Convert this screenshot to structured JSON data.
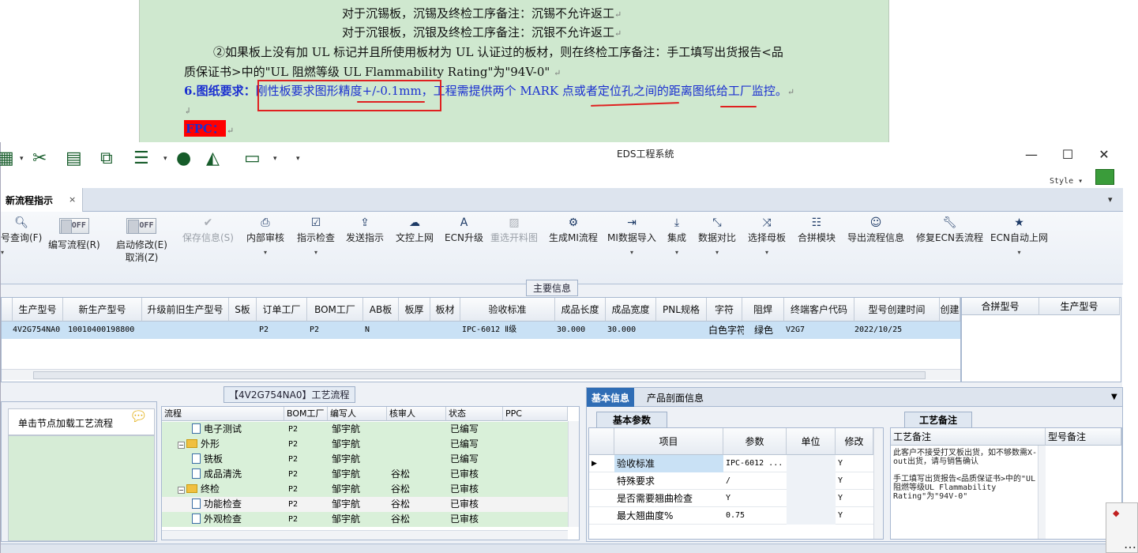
{
  "document": {
    "line1": "对于沉锡板，沉锡及终检工序备注：沉锡不允许返工",
    "line2": "对于沉银板，沉银及终检工序备注：沉银不允许返工",
    "line3": "②如果板上没有加 UL 标记并且所使用板材为 UL 认证过的板材，则在终检工序备注：手工填写出货报告<品",
    "line4": "质保证书>中的\"UL 阻燃等级 UL Flammability Rating\"为\"94V-0\"",
    "line5_label": "6.图纸要求：",
    "line5_text": "刚性板要求图形精度+/-0.1mm，工程需提供两个 MARK 点或者定位孔之间的距离图纸给工厂监控。",
    "fpc_label": "FPC：",
    "para_mark": "↵",
    "return_mark": "↲"
  },
  "window": {
    "title": "EDS工程系统",
    "minimize": "—",
    "maximize": "☐",
    "close": "✕",
    "style_label": "Style ▾",
    "quick_access_more": "▾"
  },
  "tabs": {
    "active": "新流程指示",
    "close": "×",
    "dropdown": "▾"
  },
  "ribbon": {
    "query": "号查询(F)",
    "edit_flow_toggle": "OFF",
    "edit_flow": "编写流程(R)",
    "start_modify_toggle": "OFF",
    "start_modify": "启动修改(E)",
    "cancel": "取消(Z)",
    "save_info": "保存信息(S)",
    "internal_review": "内部审核",
    "instruction_check": "指示检查",
    "send_instruction": "发送指示",
    "doc_upload": "文控上网",
    "ecn_upgrade": "ECN升级",
    "reselect_cut": "重选开料图",
    "generate_mi": "生成MI流程",
    "mi_import": "MI数据导入",
    "integrate": "集成",
    "data_compare": "数据对比",
    "select_master": "选择母板",
    "merge_module": "合拼模块",
    "export_flow": "导出流程信息",
    "fix_ecn": "修复ECN丢流程",
    "ecn_auto_upload": "ECN自动上网"
  },
  "main_info": {
    "label": "主要信息",
    "headers": [
      "生产型号",
      "新生产型号",
      "升级前旧生产型号",
      "S板",
      "订单工厂",
      "BOM工厂",
      "AB板",
      "板厚",
      "板材",
      "验收标准",
      "成品长度",
      "成品宽度",
      "PNL规格",
      "字符",
      "阻焊",
      "终端客户代码",
      "型号创建时间",
      "创建"
    ],
    "row": [
      "4V2G754NA0",
      "10010400198800",
      "",
      "",
      "P2",
      "P2",
      "N",
      "",
      "",
      "IPC-6012 Ⅱ级",
      "30.000",
      "30.000",
      "",
      "白色字符",
      "绿色",
      "V2G7",
      "2022/10/25",
      ""
    ],
    "side_headers": [
      "合拼型号",
      "生产型号"
    ]
  },
  "process": {
    "label": "【4V2G754NA0】工艺流程",
    "load_hint": "单击节点加载工艺流程",
    "headers": [
      "流程",
      "BOM工厂",
      "编写人",
      "核审人",
      "状态",
      "PPC"
    ],
    "rows": [
      {
        "name": "电子测试",
        "bom": "P2",
        "writer": "邹宇航",
        "reviewer": "",
        "status": "已编写",
        "type": "file",
        "indent": 2
      },
      {
        "name": "外形",
        "bom": "P2",
        "writer": "邹宇航",
        "reviewer": "",
        "status": "已编写",
        "type": "folder",
        "indent": 1
      },
      {
        "name": "铣板",
        "bom": "P2",
        "writer": "邹宇航",
        "reviewer": "",
        "status": "已编写",
        "type": "file",
        "indent": 2
      },
      {
        "name": "成品清洗",
        "bom": "P2",
        "writer": "邹宇航",
        "reviewer": "谷松",
        "status": "已审核",
        "type": "file",
        "indent": 2
      },
      {
        "name": "终检",
        "bom": "P2",
        "writer": "邹宇航",
        "reviewer": "谷松",
        "status": "已审核",
        "type": "folder",
        "indent": 1
      },
      {
        "name": "功能检查",
        "bom": "P2",
        "writer": "邹宇航",
        "reviewer": "谷松",
        "status": "已审核",
        "type": "file",
        "indent": 2
      },
      {
        "name": "外观检查",
        "bom": "P2",
        "writer": "邹宇航",
        "reviewer": "谷松",
        "status": "已审核",
        "type": "file",
        "indent": 2
      }
    ]
  },
  "right_panel": {
    "tab_basic": "基本信息",
    "tab_profile": "产品剖面信息",
    "basic_params_tab": "基本参数",
    "param_headers": [
      "项目",
      "参数",
      "单位",
      "修改"
    ],
    "params": [
      {
        "item": "验收标准",
        "value": "IPC-6012 ...",
        "unit": "",
        "modify": "Y"
      },
      {
        "item": "特殊要求",
        "value": "/",
        "unit": "",
        "modify": "Y"
      },
      {
        "item": "是否需要翘曲检查",
        "value": "Y",
        "unit": "",
        "modify": "Y"
      },
      {
        "item": "最大翘曲度%",
        "value": "0.75",
        "unit": "",
        "modify": "Y"
      }
    ],
    "notes_tab": "工艺备注",
    "notes_headers": [
      "工艺备注",
      "型号备注"
    ],
    "notes_text": "此客户不接受打叉板出货，如不够数需X-out出货，请与销售确认\n\n手工填写出货报告<品质保证书>中的\"UL阻燃等级UL Flammability Rating\"为\"94V-0\""
  },
  "colors": {
    "doc_green": "#cfe8cf",
    "highlight_red": "#e02020",
    "selected_row": "#c9e1f5",
    "tab_blue": "#2f6db5"
  }
}
